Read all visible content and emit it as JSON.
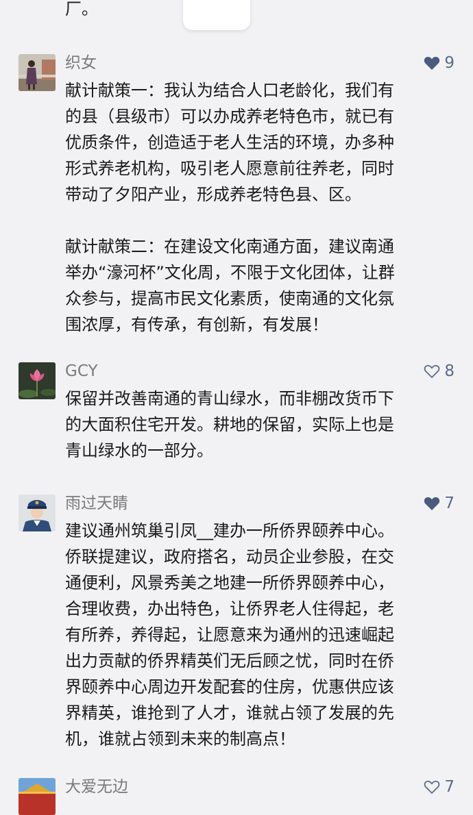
{
  "top_fragment": "厂。",
  "comments": [
    {
      "user": "织女",
      "likes": "9",
      "liked": true,
      "paragraphs": [
        "献计献策一：我认为结合人口老龄化，我们有\n的县（县级市）可以办成养老特色市，就已有\n优质条件，创造适于老人生活的环境，办多种\n形式养老机构，吸引老人愿意前往养老，同时\n带动了夕阳产业，形成养老特色县、区。",
        "献计献策二：在建设文化南通方面，建议南通\n举办“濠河杯”文化周，不限于文化团体，让群\n众参与，提高市民文化素质，使南通的文化氛\n围浓厚，有传承，有创新，有发展！"
      ]
    },
    {
      "user": "GCY",
      "likes": "8",
      "liked": false,
      "paragraphs": [
        "保留并改善南通的青山绿水，而非棚改货币下\n的大面积住宅开发。耕地的保留，实际上也是\n青山绿水的一部分。"
      ]
    },
    {
      "user": "雨过天睛",
      "likes": "7",
      "liked": true,
      "paragraphs": [
        "建议通州筑巢引凤__建办一所侨界颐养中心。\n侨联提建议，政府搭名，动员企业参股，在交\n通便利，风景秀美之地建一所侨界颐养中心，\n合理收费，办出特色，让侨界老人住得起，老\n有所养，养得起，让愿意来为通州的迅速崛起\n出力贡献的侨界精英们无后顾之忧，同时在侨\n界颐养中心周边开发配套的住房，优惠供应该\n界精英，谁抢到了人才，谁就占领了发展的先\n机，谁就占领到未来的制高点！"
      ]
    },
    {
      "user": "大爱无边",
      "likes": "7",
      "liked": false,
      "paragraphs": []
    }
  ],
  "colors": {
    "background": "#f2f2f4",
    "like_active": "#4a5b7e",
    "like_outline": "#5a6b8c",
    "username": "#7a7a7a",
    "text": "#1a1a1a"
  },
  "icons": {
    "like": "heart-icon"
  }
}
